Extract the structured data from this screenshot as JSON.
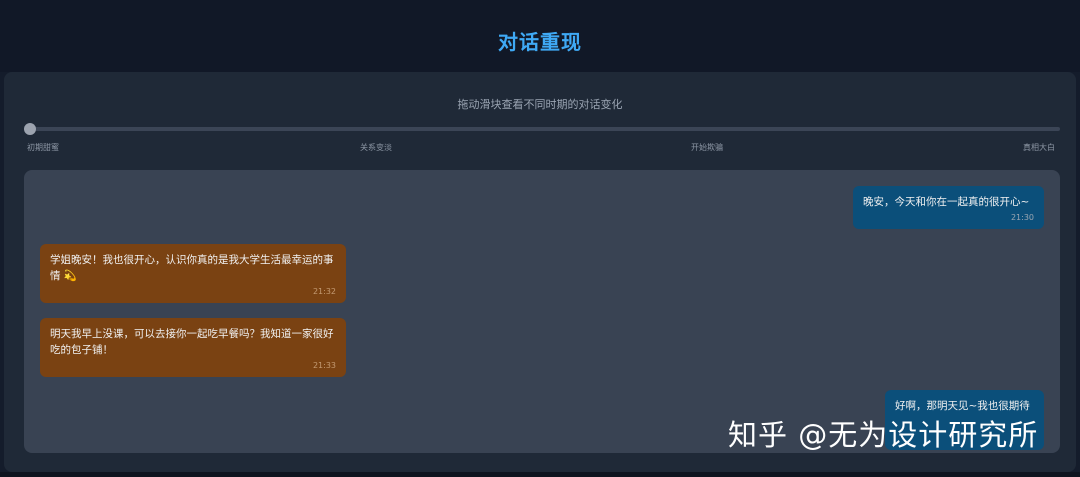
{
  "header": {
    "title": "对话重现"
  },
  "timeline": {
    "hint": "拖动滑块查看不同时期的对话变化",
    "position": 0,
    "stages": [
      "初期甜蜜",
      "关系变淡",
      "开始欺骗",
      "真相大白"
    ]
  },
  "messages": [
    {
      "side": "mine",
      "text": "晚安，今天和你在一起真的很开心~",
      "time": "21:30"
    },
    {
      "side": "theirs",
      "text": "学姐晚安！我也很开心，认识你真的是我大学生活最幸运的事情 💫",
      "time": "21:32"
    },
    {
      "side": "theirs",
      "text": "明天我早上没课，可以去接你一起吃早餐吗？我知道一家很好吃的包子铺！",
      "time": "21:33"
    },
    {
      "side": "mine",
      "text": "好啊，那明天见~我也很期待",
      "time": ""
    }
  ],
  "watermark": "知乎 @无为设计研究所",
  "colors": {
    "title": "#3fa9f5",
    "mine_bubble": "#0b4f7a",
    "theirs_bubble": "#7a4212",
    "chat_bg": "#394353",
    "card_bg": "#1f2937"
  }
}
